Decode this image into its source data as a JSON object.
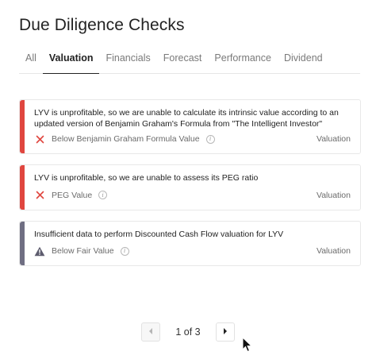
{
  "page": {
    "title": "Due Diligence Checks"
  },
  "tabs": [
    {
      "label": "All",
      "active": false
    },
    {
      "label": "Valuation",
      "active": true
    },
    {
      "label": "Financials",
      "active": false
    },
    {
      "label": "Forecast",
      "active": false
    },
    {
      "label": "Performance",
      "active": false
    },
    {
      "label": "Dividend",
      "active": false
    }
  ],
  "checks": [
    {
      "message": "LYV is unprofitable, so we are unable to calculate its intrinsic value according to an updated version of Benjamin Graham's Formula from \"The Intelligent Investor\"",
      "label": "Below Benjamin Graham Formula Value",
      "category": "Valuation",
      "status": "fail",
      "status_icon": "x-icon",
      "accent_color": "#e0463f"
    },
    {
      "message": "LYV is unprofitable, so we are unable to assess its PEG ratio",
      "label": "PEG Value",
      "category": "Valuation",
      "status": "fail",
      "status_icon": "x-icon",
      "accent_color": "#e0463f"
    },
    {
      "message": "Insufficient data to perform Discounted Cash Flow valuation for LYV",
      "label": "Below Fair Value",
      "category": "Valuation",
      "status": "warning",
      "status_icon": "warning-icon",
      "accent_color": "#6f6e82"
    }
  ],
  "pagination": {
    "text": "1 of 3",
    "current": 1,
    "total": 3
  },
  "colors": {
    "fail": "#e0463f",
    "warning": "#6f6e82",
    "active_tab": "#222222"
  }
}
